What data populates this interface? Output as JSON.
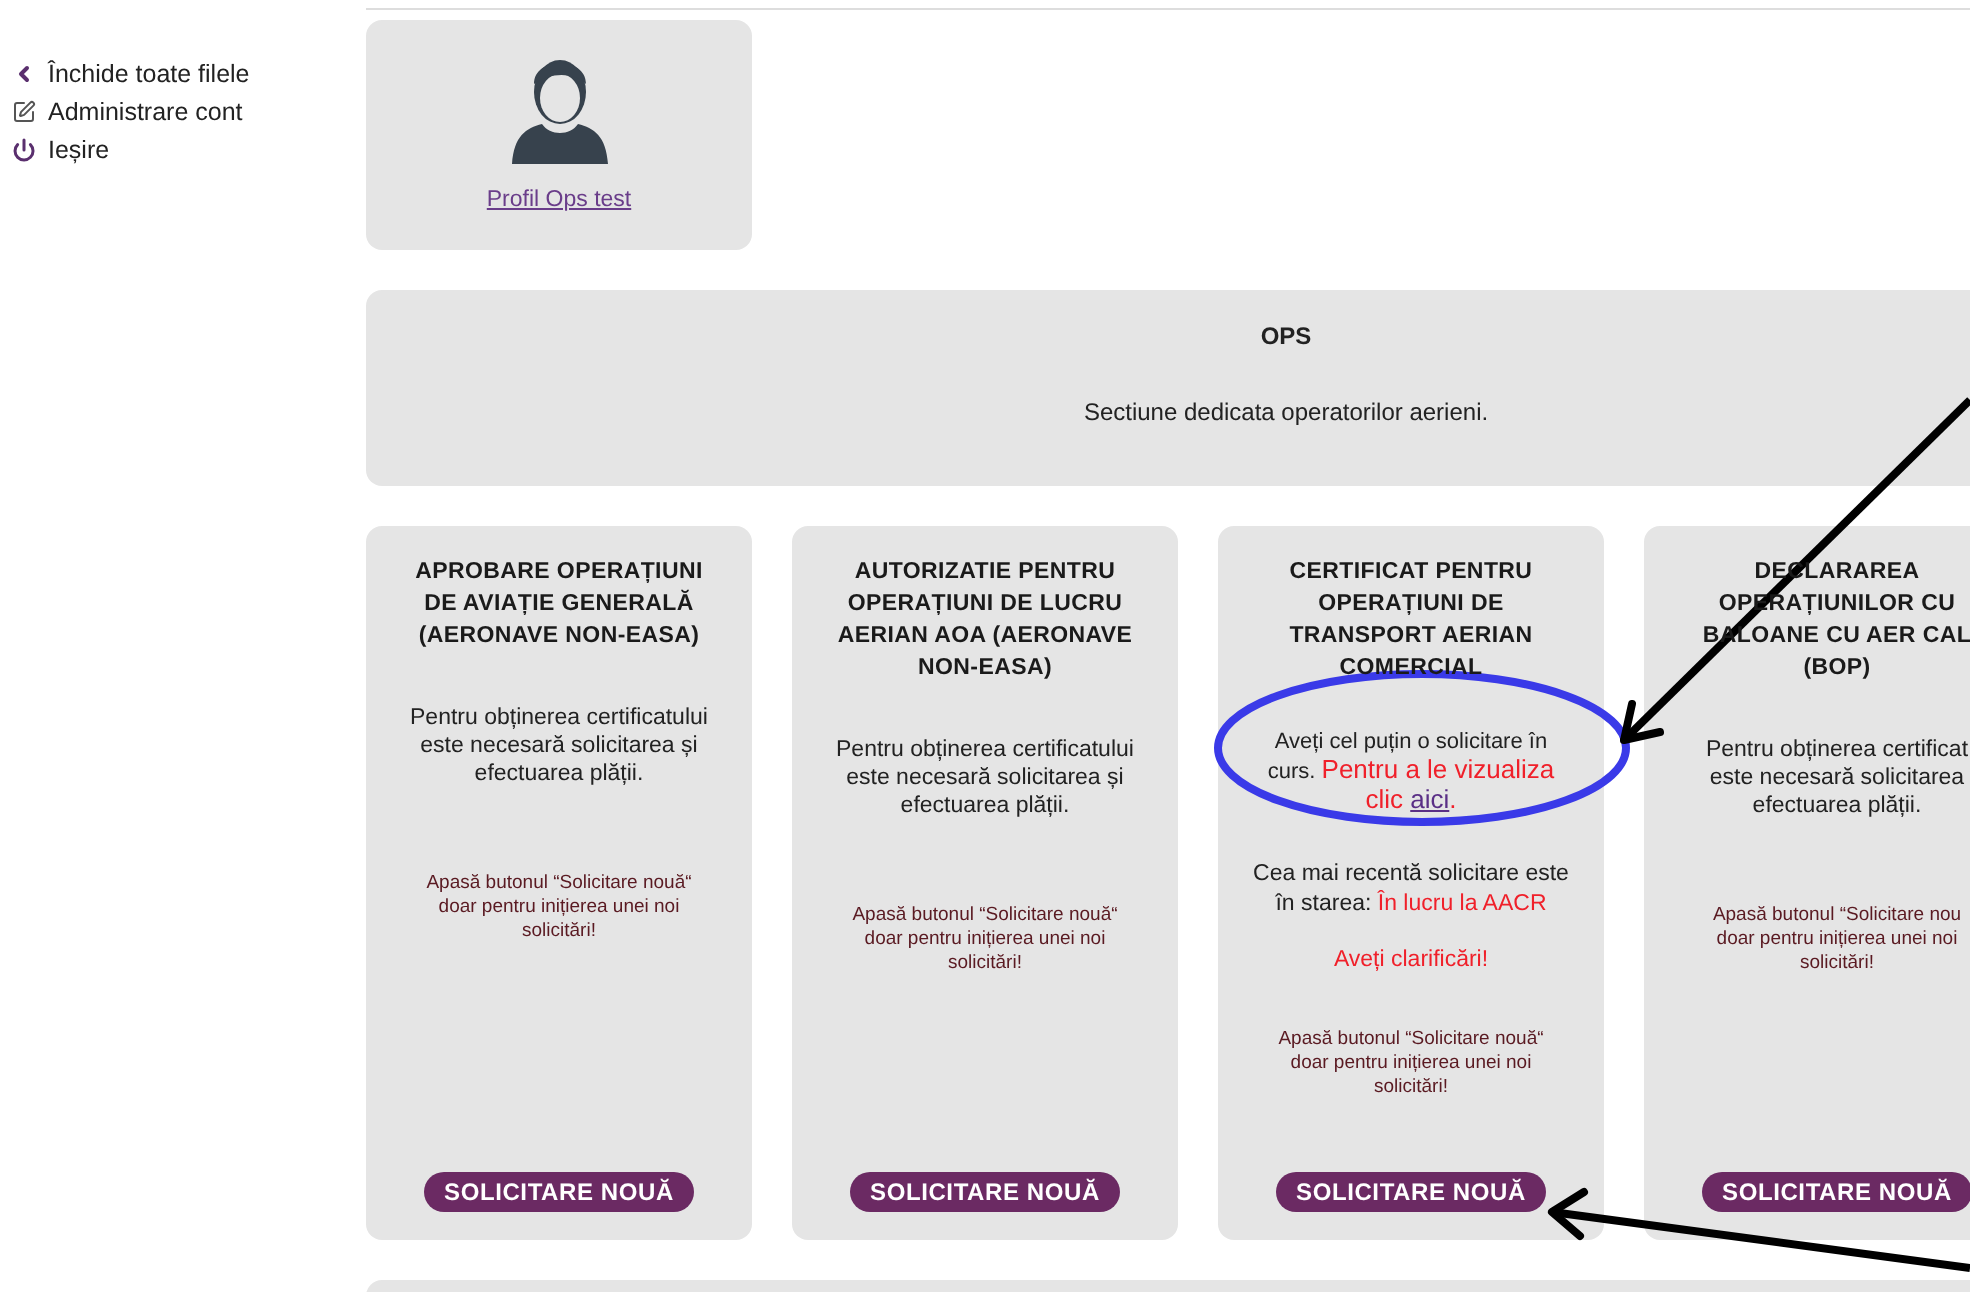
{
  "sidebar": {
    "items": [
      {
        "label": "Închide toate filele",
        "kind": "close-tabs"
      },
      {
        "label": "Administrare cont",
        "kind": "account"
      },
      {
        "label": "Ieșire",
        "kind": "logout"
      }
    ]
  },
  "profile": {
    "link": "Profil Ops test"
  },
  "section": {
    "title": "OPS",
    "subtitle": "Sectiune dedicata operatorilor aerieni."
  },
  "cards": [
    {
      "kind": "info",
      "title": "APROBARE OPERAȚIUNI\nDE AVIAȚIE GENERALĂ\n(AERONAVE NON-EASA)",
      "body": "Pentru obținerea certificatului\neste necesară solicitarea și\nefectuarea plății.",
      "hint": "Apasă butonul “Solicitare nouă“\ndoar pentru inițierea unei noi\nsolicitări!",
      "button": "SOLICITARE NOUĂ"
    },
    {
      "kind": "info",
      "title": "AUTORIZATIE PENTRU\nOPERAȚIUNI DE LUCRU\nAERIAN AOA (AERONAVE\nNON-EASA)",
      "body": "Pentru obținerea certificatului\neste necesară solicitarea și\nefectuarea plății.",
      "hint": "Apasă butonul “Solicitare nouă“\ndoar pentru inițierea unei noi\nsolicitări!",
      "button": "SOLICITARE NOUĂ"
    },
    {
      "kind": "request",
      "title": "CERTIFICAT PENTRU\nOPERAȚIUNI DE\nTRANSPORT AERIAN\nCOMERCIAL",
      "notice": {
        "text": "Aveți cel puțin o solicitare în curs.",
        "highlight": "Pentru a le vizualiza clic",
        "link": "aici",
        "end": "."
      },
      "status": {
        "text": "Cea mai recentă solicitare este în starea:",
        "value": "În lucru la AACR"
      },
      "alert": "Aveți clarificări!",
      "hint": "Apasă butonul “Solicitare nouă“\ndoar pentru inițierea unei noi\nsolicitări!",
      "button": "SOLICITARE NOUĂ"
    },
    {
      "kind": "info",
      "title": "DECLARAREA\nOPERAȚIUNILOR CU\nBALOANE CU AER CAL\n(BOP)",
      "body": "Pentru obținerea certificat\neste necesară solicitarea\nefectuarea plății.",
      "hint": "Apasă butonul “Solicitare nou\ndoar pentru inițierea unei noi\nsolicitări!",
      "button": "SOLICITARE NOUĂ"
    }
  ],
  "annotations": [
    {
      "kind": "ellipse"
    },
    {
      "kind": "arrow"
    },
    {
      "kind": "arrow"
    }
  ]
}
